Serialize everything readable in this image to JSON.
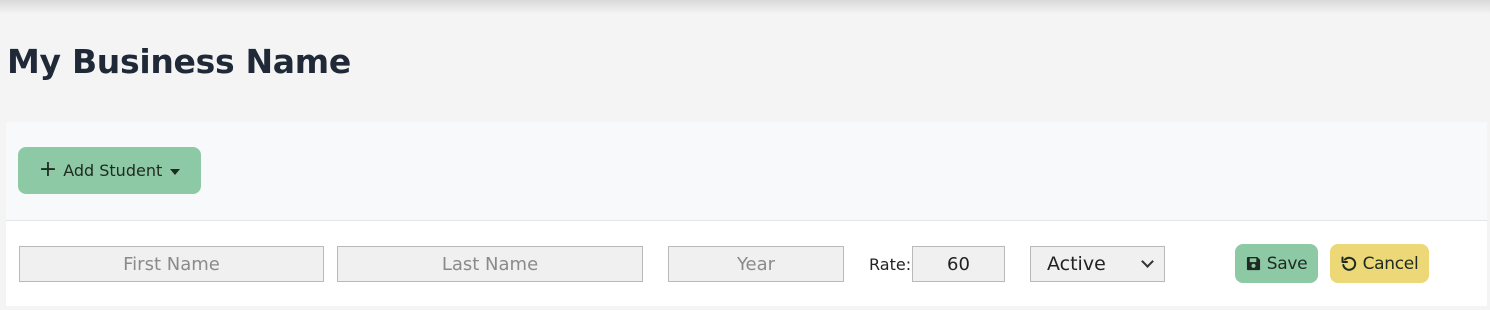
{
  "page": {
    "title": "My Business Name"
  },
  "toolbar": {
    "add_student_label": "Add Student"
  },
  "form": {
    "first_name": {
      "placeholder": "First Name",
      "value": ""
    },
    "last_name": {
      "placeholder": "Last Name",
      "value": ""
    },
    "year": {
      "placeholder": "Year",
      "value": ""
    },
    "rate_label": "Rate:",
    "rate_value": "60",
    "status_selected": "Active",
    "save_label": "Save",
    "cancel_label": "Cancel"
  },
  "icons": {
    "add": "plus-icon",
    "dropdown": "caret-down-icon",
    "save": "floppy-disk-icon",
    "cancel": "undo-icon",
    "select": "chevron-down-icon"
  },
  "colors": {
    "primary_button": "#8dc9a4",
    "cancel_button": "#ecd877",
    "title": "#1f2937"
  }
}
